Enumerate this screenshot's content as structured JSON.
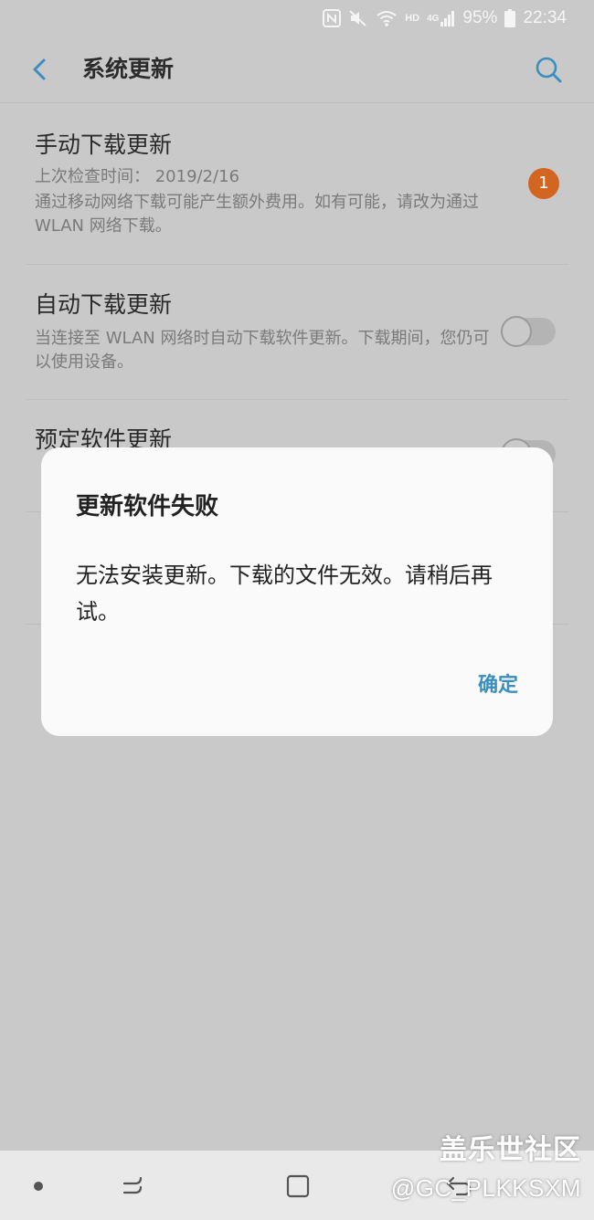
{
  "status_bar": {
    "nfc": "N",
    "network": "HD",
    "network_type": "4G",
    "battery": "95%",
    "time": "22:34"
  },
  "header": {
    "title": "系统更新",
    "back_icon": "chevron-left-icon",
    "search_icon": "search-icon"
  },
  "items": [
    {
      "title": "手动下载更新",
      "subtitle": "上次检查时间： 2019/2/16",
      "desc": "通过移动网络下载可能产生额外费用。如有可能，请改为通过 WLAN 网络下载。",
      "badge": "1"
    },
    {
      "title": "自动下载更新",
      "desc": "当连接至 WLAN 网络时自动下载软件更新。下载期间，您仍可以使用设备。",
      "toggle_on": false
    },
    {
      "title": "预定软件更新",
      "toggle_on": false
    }
  ],
  "dialog": {
    "title": "更新软件失败",
    "message": "无法安装更新。下载的文件无效。请稍后再试。",
    "confirm": "确定"
  },
  "watermark": {
    "community": "盖乐世社区",
    "user": "@GC_PLKKSXM"
  },
  "colors": {
    "accent": "#3b8fc0",
    "badge": "#d2651f",
    "background_dimmed": "#c9c9c9"
  }
}
